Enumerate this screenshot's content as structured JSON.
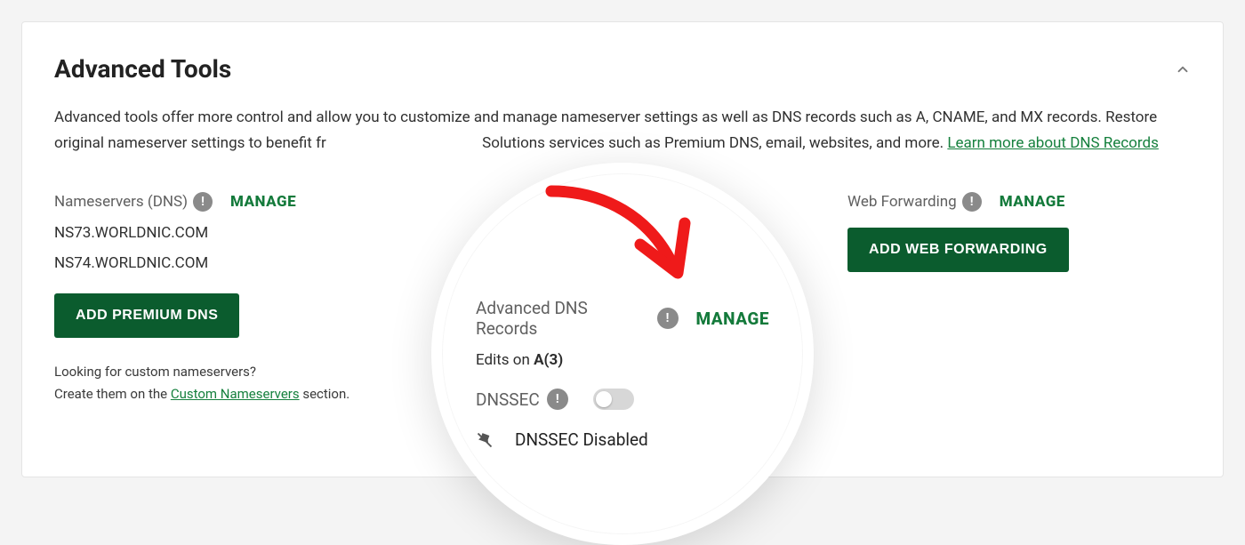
{
  "card": {
    "title": "Advanced Tools",
    "description_pre": "Advanced tools offer more control and allow you to customize and manage nameserver settings as well as DNS records such as A, CNAME, and MX records. Restore original nameserver settings to benefit fr",
    "description_post": " Solutions services such as Premium DNS, email, websites, and more. ",
    "learn_more": "Learn more about DNS Records",
    "nameservers": {
      "label": "Nameservers (DNS)",
      "manage": "MANAGE",
      "servers": [
        "NS73.WORLDNIC.COM",
        "NS74.WORLDNIC.COM"
      ],
      "add_button": "ADD PREMIUM DNS",
      "hint_line1": "Looking for custom nameservers?",
      "hint_line2_pre": "Create them on the ",
      "hint_link": "Custom Nameservers",
      "hint_line2_post": " section."
    },
    "dns_records": {
      "label": "Advanced DNS Records",
      "manage": "MANAGE",
      "edits_pre": "Edits on ",
      "edits_bold": "A(3)",
      "dnssec_label": "DNSSEC",
      "dnssec_state": "DNSSEC Disabled",
      "dnssec_on": false
    },
    "web_forwarding": {
      "label": "Web Forwarding",
      "manage": "MANAGE",
      "add_button": "ADD WEB FORWARDING"
    }
  }
}
